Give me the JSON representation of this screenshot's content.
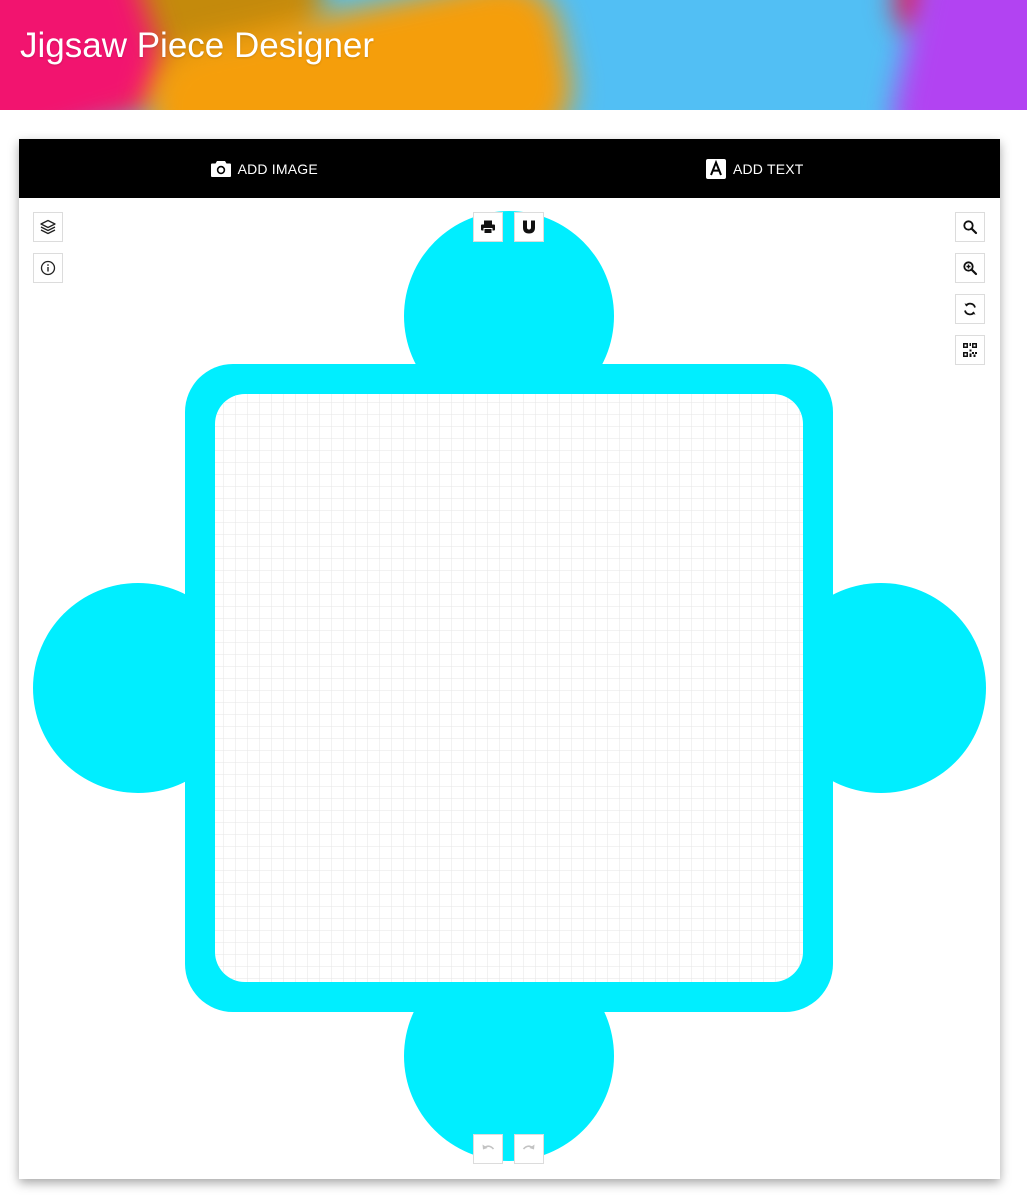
{
  "header": {
    "title": "Jigsaw Piece Designer"
  },
  "toolbar": {
    "add_image_label": "ADD IMAGE",
    "add_text_label": "ADD TEXT"
  },
  "canvas": {
    "piece_color": "#00eeff",
    "background_color": "#ffffff",
    "grid_color": "#e6e6e6"
  },
  "controls": {
    "left": [
      "layers-icon",
      "info-icon"
    ],
    "top": [
      "print-icon",
      "magnet-icon"
    ],
    "right": [
      "search-icon",
      "zoom-in-icon",
      "refresh-icon",
      "qr-code-icon"
    ],
    "bottom": [
      "undo-icon",
      "redo-icon"
    ]
  }
}
